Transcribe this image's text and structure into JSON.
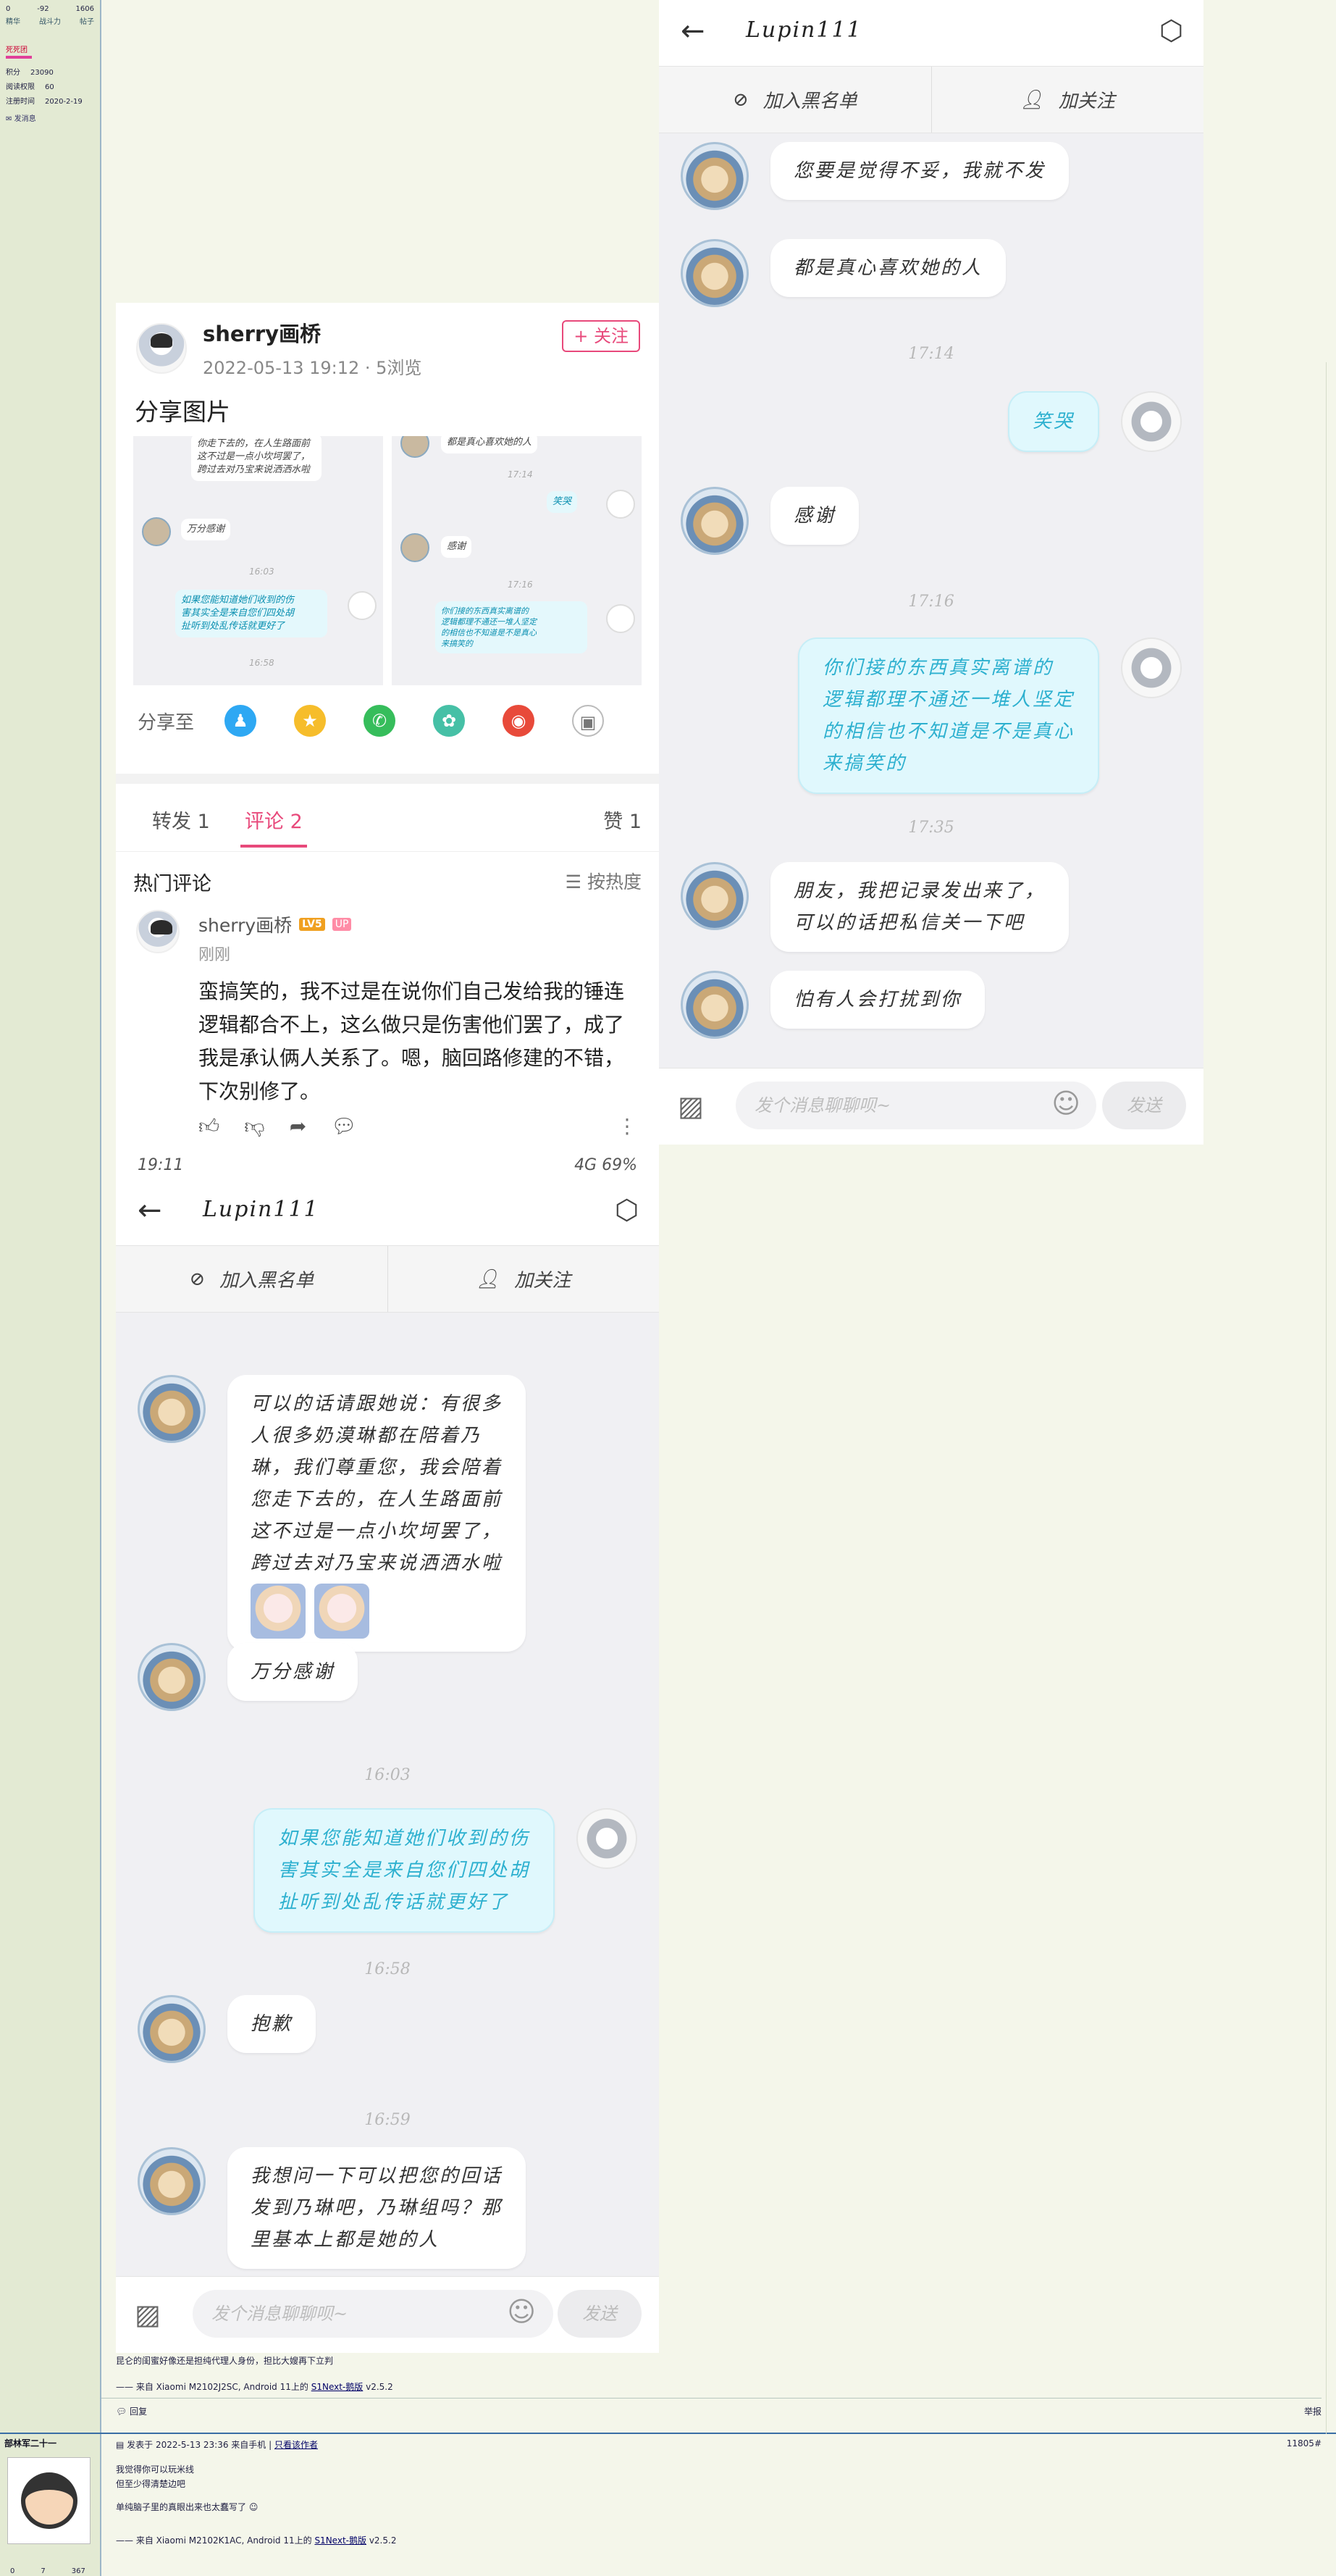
{
  "forum_sidebar": {
    "stats_values": [
      "0",
      "-92",
      "1606"
    ],
    "stats_labels": [
      "精华",
      "战斗力",
      "帖子"
    ],
    "group": "死死团",
    "fields": [
      {
        "label": "积分",
        "value": "23090"
      },
      {
        "label": "阅读权限",
        "value": "60"
      },
      {
        "label": "注册时间",
        "value": "2020-2-19"
      }
    ],
    "send_message": "发消息"
  },
  "weibo": {
    "author": "sherry画桥",
    "meta": "2022-05-13 19:12 · 5浏览",
    "follow": "+ 关注",
    "text": "分享图片",
    "thumb_left": {
      "b1": "你走下去的，在人生路面前\n这不过是一点小坎坷罢了，\n跨过去对乃宝来说洒洒水啦",
      "b2": "万分感谢",
      "ts1": "16:03",
      "b3": "如果您能知道她们收到的伤\n害其实全是来自您们四处胡\n扯听到处乱传话就更好了",
      "ts2": "16:58"
    },
    "thumb_right": {
      "b1": "都是真心喜欢她的人",
      "ts1": "17:14",
      "b2": "笑哭",
      "b3": "感谢",
      "ts2": "17:16",
      "b4": "你们接的东西真实离谱的\n逻辑都理不通还一堆人坚定\n的相信也不知道是不是真心\n来搞笑的"
    },
    "share_label": "分享至",
    "share_icons": [
      "qq-icon",
      "qzone-icon",
      "wechat-icon",
      "moments-icon",
      "weibo-icon",
      "image-icon"
    ],
    "tabs": {
      "forward": "转发 1",
      "comment": "评论 2",
      "like": "赞 1"
    },
    "hot_title": "热门评论",
    "sort": "☰ 按热度",
    "comment": {
      "name": "sherry画桥",
      "level": "LV5",
      "up": "UP",
      "time": "刚刚",
      "text": "蛮搞笑的，我不过是在说你们自己发给我的锤连逻辑都合不上，这么做只是伤害他们罢了，成了我是承认俩人关系了。嗯，脑回路修建的不错，下次别修了。"
    },
    "status_left": "19:11",
    "status_right": "4G  69%"
  },
  "chat_a": {
    "title": "Lupin111",
    "block": "加入黑名单",
    "follow": "加关注",
    "m1": "可以的话请跟她说：有很多\n人很多奶漠琳都在陪着乃\n琳，我们尊重您，我会陪着\n您走下去的，在人生路面前\n这不过是一点小坎坷罢了，\n跨过去对乃宝来说洒洒水啦",
    "m2": "万分感谢",
    "ts1": "16:03",
    "m3": "如果您能知道她们收到的伤\n害其实全是来自您们四处胡\n扯听到处乱传话就更好了",
    "ts2": "16:58",
    "m4": "抱歉",
    "ts3": "16:59",
    "m5": "我想问一下可以把您的回话\n发到乃琳吧，乃琳组吗？那\n里基本上都是她的人",
    "input_placeholder": "发个消息聊聊呗~",
    "send": "发送"
  },
  "chat_b": {
    "title": "Lupin111",
    "block": "加入黑名单",
    "follow": "加关注",
    "m1": "您要是觉得不妥，我就不发",
    "m2": "都是真心喜欢她的人",
    "ts1": "17:14",
    "m3": "笑哭",
    "m4": "感谢",
    "ts2": "17:16",
    "m5": "你们接的东西真实离谱的\n逻辑都理不通还一堆人坚定\n的相信也不知道是不是真心\n来搞笑的",
    "ts3": "17:35",
    "m6": "朋友，我把记录发出来了，\n可以的话把私信关一下吧",
    "m7": "怕有人会打扰到你",
    "input_placeholder": "发个消息聊聊呗~",
    "send": "发送"
  },
  "forum_post1": {
    "line1": "昆仑的闺蜜好像还是担纯代理人身份，担比大嫂再下立判",
    "device": "—— 来自 Xiaomi M2102J2SC, Android 11上的",
    "app_link": "S1Next-鹅版",
    "app_ver": "v2.5.2",
    "reply": "回复",
    "report": "举报"
  },
  "forum_post2": {
    "author": "部林军二十一",
    "posted": "发表于 2022-5-13 23:36 来自手机",
    "only_author": "只看该作者",
    "floor": "11805#",
    "line1": "我觉得你可以玩米线",
    "line2": "但至少得清楚边吧",
    "line3": "单纯脑子里的真眼出来也太蠢写了",
    "device": "—— 来自 Xiaomi M2102K1AC, Android 11上的",
    "app_link": "S1Next-鹅版",
    "app_ver": "v2.5.2",
    "stats": [
      "0",
      "7",
      "367"
    ]
  }
}
